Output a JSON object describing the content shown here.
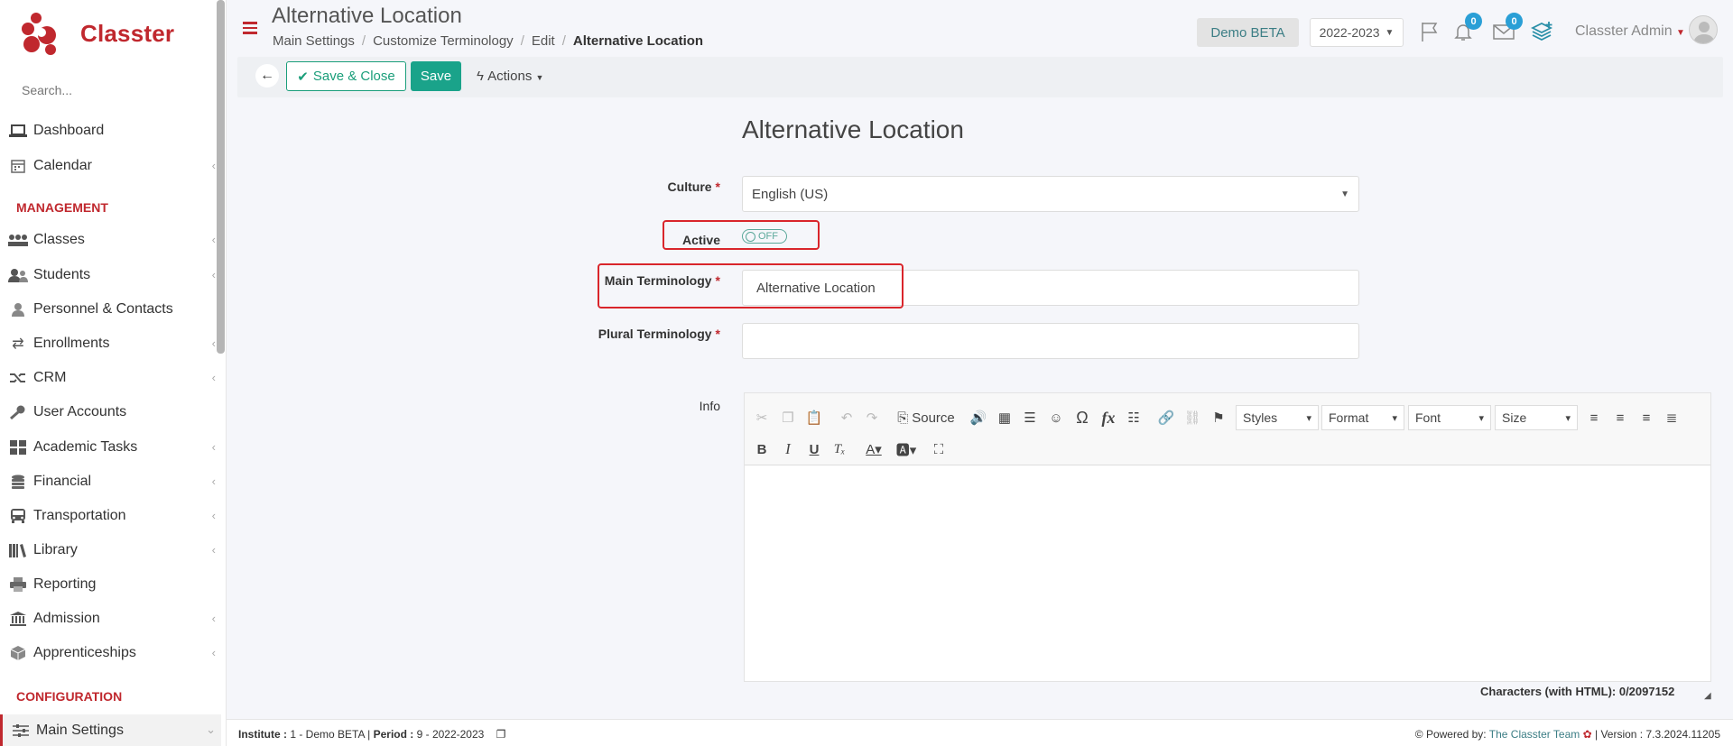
{
  "app": {
    "name": "Classter"
  },
  "sidebar": {
    "search_placeholder": "Search...",
    "items": [
      {
        "label": "Dashboard",
        "icon": "laptop-icon"
      },
      {
        "label": "Calendar",
        "icon": "calendar-icon"
      },
      {
        "label": "Classes",
        "icon": "classes-icon"
      },
      {
        "label": "Students",
        "icon": "students-icon"
      },
      {
        "label": "Personnel & Contacts",
        "icon": "person-icon"
      },
      {
        "label": "Enrollments",
        "icon": "exchange-icon"
      },
      {
        "label": "CRM",
        "icon": "shuffle-icon"
      },
      {
        "label": "User Accounts",
        "icon": "key-icon"
      },
      {
        "label": "Academic Tasks",
        "icon": "grid-icon"
      },
      {
        "label": "Financial",
        "icon": "coins-icon"
      },
      {
        "label": "Transportation",
        "icon": "bus-icon"
      },
      {
        "label": "Library",
        "icon": "books-icon"
      },
      {
        "label": "Reporting",
        "icon": "printer-icon"
      },
      {
        "label": "Admission",
        "icon": "bank-icon"
      },
      {
        "label": "Apprenticeships",
        "icon": "cube-icon"
      },
      {
        "label": "Main Settings",
        "icon": "sliders-icon"
      }
    ],
    "sections": {
      "management": "MANAGEMENT",
      "configuration": "CONFIGURATION"
    }
  },
  "header": {
    "title": "Alternative Location",
    "breadcrumb": [
      "Main Settings",
      "Customize Terminology",
      "Edit",
      "Alternative Location"
    ],
    "institute_btn": "Demo BETA",
    "year": "2022-2023",
    "notifications": "0",
    "messages": "0",
    "user": "Classter Admin"
  },
  "toolbar": {
    "save_close": "Save & Close",
    "save": "Save",
    "actions": "Actions"
  },
  "form": {
    "title": "Alternative Location",
    "culture_label": "Culture",
    "culture_value": "English (US)",
    "active_label": "Active",
    "active_state": "OFF",
    "main_label": "Main Terminology",
    "main_value": "Alternative Location",
    "plural_label": "Plural Terminology",
    "plural_value": "",
    "info_label": "Info"
  },
  "editor": {
    "source": "Source",
    "styles": "Styles",
    "format": "Format",
    "font": "Font",
    "size": "Size",
    "chars": "Characters (with HTML): 0/2097152"
  },
  "footer": {
    "institute_label": "Institute :",
    "institute_value": " 1 - Demo BETA | ",
    "period_label": "Period :",
    "period_value": " 9 - 2022-2023",
    "powered": "Powered by: ",
    "team": "The Classter Team",
    "version": " | Version : 7.3.2024.11205"
  },
  "colors": {
    "brand": "#c0282e",
    "accent": "#1aa38a",
    "highlight": "#d9252b"
  }
}
